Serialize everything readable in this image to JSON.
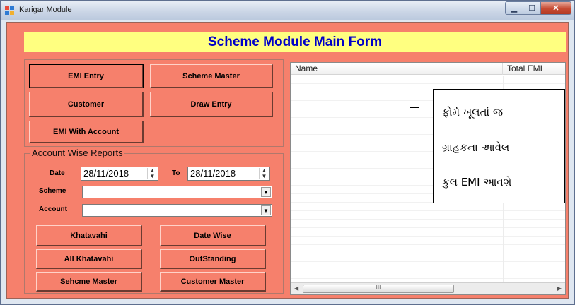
{
  "window": {
    "title": "Karigar Module",
    "controls": {
      "minimize": "▁",
      "maximize": "☐",
      "close": "✕"
    }
  },
  "header": {
    "title": "Scheme Module Main Form"
  },
  "main_buttons": {
    "emi_entry": "EMI Entry",
    "scheme_master": "Scheme Master",
    "customer": "Customer",
    "draw_entry": "Draw Entry",
    "emi_with_account": "EMI With Account"
  },
  "reports": {
    "group_title": "Account Wise Reports",
    "date_label": "Date",
    "date_from": "28/11/2018",
    "to_label": "To",
    "date_to": "28/11/2018",
    "scheme_label": "Scheme",
    "scheme_value": "",
    "account_label": "Account",
    "account_value": "",
    "buttons": {
      "khatavahi": "Khatavahi",
      "date_wise": "Date Wise",
      "all_khatavahi": "All Khatavahi",
      "outstanding": "OutStanding",
      "sehcme_master": "Sehcme Master",
      "customer_master": "Customer Master"
    }
  },
  "listview": {
    "columns": [
      "Name",
      "Total EMI"
    ],
    "rows": [],
    "scroll_thumb": "III"
  },
  "callout": {
    "lines": [
      "ફોર્મ ખૂલતાં જ",
      "ગ્રાહકના આવેલ",
      "કુલ EMI આવશે"
    ]
  },
  "icons": {
    "spin_up": "▲",
    "spin_down": "▼",
    "combo_arrow": "▼",
    "scroll_left": "◀",
    "scroll_right": "▶"
  },
  "colors": {
    "form_background": "#f6806c",
    "header_background": "#ffff80",
    "header_text": "#0000c8"
  }
}
